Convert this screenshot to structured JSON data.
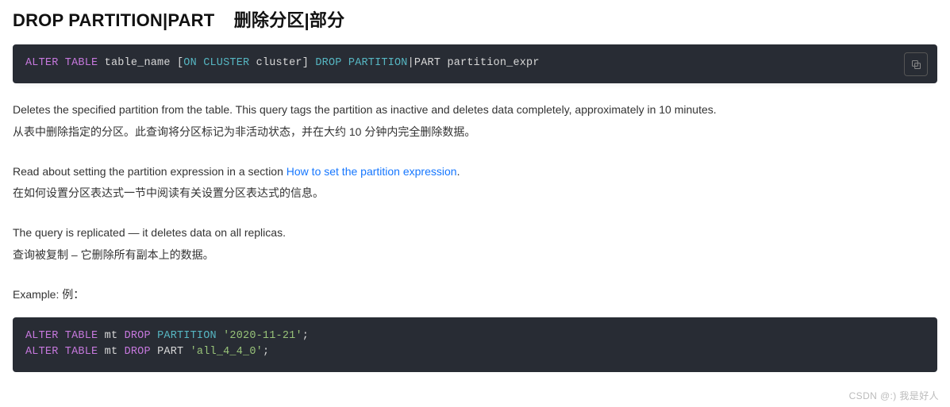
{
  "heading": {
    "english": "DROP PARTITION|PART",
    "chinese": "删除分区|部分"
  },
  "code1": {
    "tokens": {
      "alter_table": "ALTER TABLE",
      "table_name": "table_name",
      "lbrack": "[",
      "on": "ON",
      "cluster": "CLUSTER",
      "cluster_ident": "cluster",
      "rbrack": "]",
      "drop": "DROP",
      "partition": "PARTITION",
      "pipe_part": "|PART",
      "expr": "partition_expr"
    }
  },
  "para1_en": "Deletes the specified partition from the table. This query tags the partition as inactive and deletes data completely, approximately in 10 minutes.",
  "para1_zh": "从表中删除指定的分区。此查询将分区标记为非活动状态，并在大约 10 分钟内完全删除数据。",
  "para2_en_pre": "Read about setting the partition expression in a section ",
  "para2_link": "How to set the partition expression",
  "para2_en_post": ".",
  "para2_zh": "在如何设置分区表达式一节中阅读有关设置分区表达式的信息。",
  "para3_en": "The query is replicated — it deletes data on all replicas.",
  "para3_zh": "查询被复制 – 它删除所有副本上的数据。",
  "example_label": "Example: 例：",
  "code2": {
    "line1": {
      "alter_table": "ALTER TABLE",
      "ident": "mt",
      "drop": "DROP",
      "partition": "PARTITION",
      "str": "'2020-11-21'",
      "semi": ";"
    },
    "line2": {
      "alter_table": "ALTER TABLE",
      "ident": "mt",
      "drop": "DROP",
      "part": "PART",
      "str": "'all_4_4_0'",
      "semi": ";"
    }
  },
  "watermark": "CSDN @:)   我是好人"
}
